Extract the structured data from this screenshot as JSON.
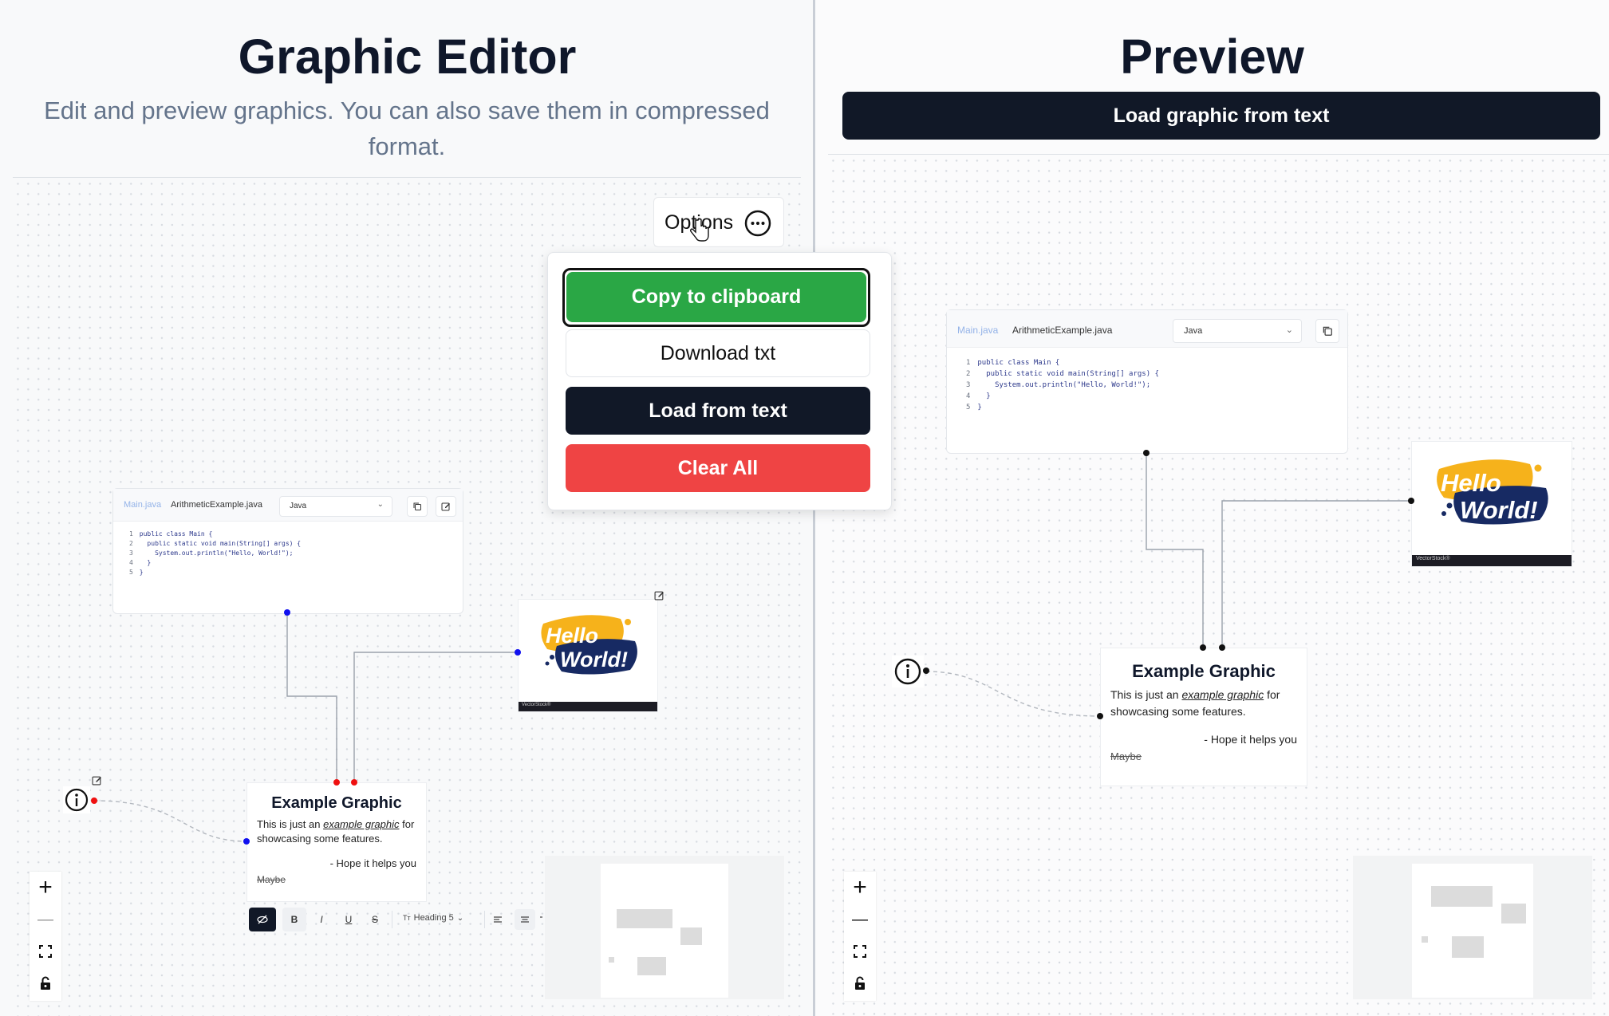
{
  "editor": {
    "title": "Graphic Editor",
    "subtitle": "Edit and preview graphics. You can also save them in compressed format.",
    "options_label": "Options",
    "menu": {
      "copy": "Copy to clipboard",
      "download": "Download txt",
      "load": "Load from text",
      "clear": "Clear All"
    },
    "code_card": {
      "tab_main": "Main.java",
      "tab_file": "ArithmeticExample.java",
      "language": "Java",
      "lines": [
        {
          "n": "1",
          "text": "public class Main {"
        },
        {
          "n": "2",
          "text": "  public static void main(String[] args) {"
        },
        {
          "n": "3",
          "text": "    System.out.println(\"Hello, World!\");"
        },
        {
          "n": "4",
          "text": "  }"
        },
        {
          "n": "5",
          "text": "}"
        }
      ]
    },
    "image_card": {
      "line1": "Hello",
      "line2": "World!",
      "brand": "VectorStock®"
    },
    "text_card": {
      "title": "Example Graphic",
      "body_pre": "This is just an ",
      "body_link": "example graphic",
      "body_post": " for showcasing some features.",
      "signoff": "- Hope it helps you",
      "struck": "Maybe"
    },
    "toolbar": {
      "bold": "B",
      "italic": "I",
      "underline": "U",
      "strike": "S",
      "heading": "Heading 5"
    },
    "controls": {
      "zoom_in": "+",
      "zoom_out": "—"
    }
  },
  "preview": {
    "title": "Preview",
    "load_button": "Load graphic from text",
    "code_card": {
      "tab_main": "Main.java",
      "tab_file": "ArithmeticExample.java",
      "language": "Java",
      "lines": [
        {
          "n": "1",
          "text": "public class Main {"
        },
        {
          "n": "2",
          "text": "  public static void main(String[] args) {"
        },
        {
          "n": "3",
          "text": "    System.out.println(\"Hello, World!\");"
        },
        {
          "n": "4",
          "text": "  }"
        },
        {
          "n": "5",
          "text": "}"
        }
      ]
    },
    "image_card": {
      "line1": "Hello",
      "line2": "World!",
      "brand": "VectorStock®"
    },
    "text_card": {
      "title": "Example Graphic",
      "body_pre": "This is just an ",
      "body_link": "example graphic",
      "body_post": " for showcasing some features.",
      "signoff": "- Hope it helps you",
      "struck": "Maybe"
    },
    "controls": {
      "zoom_in": "+",
      "zoom_out": "—"
    }
  },
  "colors": {
    "primary_dark": "#111827",
    "success": "#2aa745",
    "danger": "#ef4444",
    "handle_selected": "#ef1010",
    "handle_blue": "#1010ef"
  }
}
